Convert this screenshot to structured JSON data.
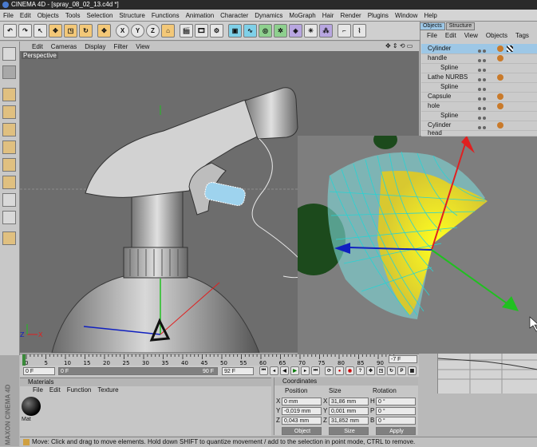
{
  "window": {
    "title": "CINEMA 4D - [spray_08_02_13.c4d *]"
  },
  "menubar": [
    "File",
    "Edit",
    "Objects",
    "Tools",
    "Selection",
    "Structure",
    "Functions",
    "Animation",
    "Character",
    "Dynamics",
    "MoGraph",
    "Hair",
    "Render",
    "Plugins",
    "Window",
    "Help"
  ],
  "toolbar": {
    "axis_x": "X",
    "axis_y": "Y",
    "axis_z": "Z"
  },
  "viewport": {
    "menu": [
      "Edit",
      "Cameras",
      "Display",
      "Filter",
      "View"
    ],
    "label": "Perspective"
  },
  "objects_panel": {
    "tabs": [
      "Objects",
      "Structure"
    ],
    "menu": [
      "File",
      "Edit",
      "View",
      "Objects",
      "Tags",
      "B"
    ],
    "items": [
      {
        "name": "Cylinder",
        "indent": 0,
        "selected": true
      },
      {
        "name": "handle",
        "indent": 0,
        "selected": false
      },
      {
        "name": "Spline",
        "indent": 1,
        "selected": false
      },
      {
        "name": "Lathe NURBS",
        "indent": 0,
        "selected": false
      },
      {
        "name": "Spline",
        "indent": 1,
        "selected": false
      },
      {
        "name": "Capsule",
        "indent": 0,
        "selected": false
      },
      {
        "name": "hole",
        "indent": 0,
        "selected": false
      },
      {
        "name": "Spline",
        "indent": 1,
        "selected": false
      },
      {
        "name": "Cylinder",
        "indent": 0,
        "selected": false
      },
      {
        "name": "head",
        "indent": 0,
        "selected": false
      }
    ]
  },
  "timeline": {
    "ticks": [
      "0",
      "5",
      "10",
      "15",
      "20",
      "25",
      "30",
      "35",
      "40",
      "45",
      "50",
      "55",
      "60",
      "65",
      "70",
      "75",
      "80",
      "85",
      "90"
    ],
    "current_frame": "-7 F",
    "start_frame": "0 F",
    "end_field": "90 F",
    "max_frame": "92 F",
    "slider_left": "0 F"
  },
  "materials_panel": {
    "title": "Materials",
    "menu": [
      "File",
      "Edit",
      "Function",
      "Texture"
    ],
    "material_name": "Mat"
  },
  "coordinates_panel": {
    "title": "Coordinates",
    "headers": [
      "Position",
      "Size",
      "Rotation"
    ],
    "rows": [
      {
        "axis": "X",
        "position": "0 mm",
        "size_axis": "X",
        "size": "31,86 mm",
        "rot_axis": "H",
        "rotation": "0 °"
      },
      {
        "axis": "Y",
        "position": "-0,019 mm",
        "size_axis": "Y",
        "size": "0,001 mm",
        "rot_axis": "P",
        "rotation": "0 °"
      },
      {
        "axis": "Z",
        "position": "0,043 mm",
        "size_axis": "Z",
        "size": "31,852 mm",
        "rot_axis": "B",
        "rotation": "0 °"
      }
    ],
    "mode_select": "Object",
    "size_select": "Size",
    "apply_label": "Apply"
  },
  "status": {
    "text": "Move: Click and drag to move elements. Hold down SHIFT to quantize movement / add to the selection in point mode, CTRL to remove."
  },
  "branding": {
    "text": "MAXON CINEMA 4D"
  },
  "colors": {
    "viewport_bg": "#6d6d6d",
    "selection_blue": "#9dc7e6",
    "axis_red": "#e02020",
    "axis_green": "#20c020",
    "axis_blue": "#1020c0"
  }
}
